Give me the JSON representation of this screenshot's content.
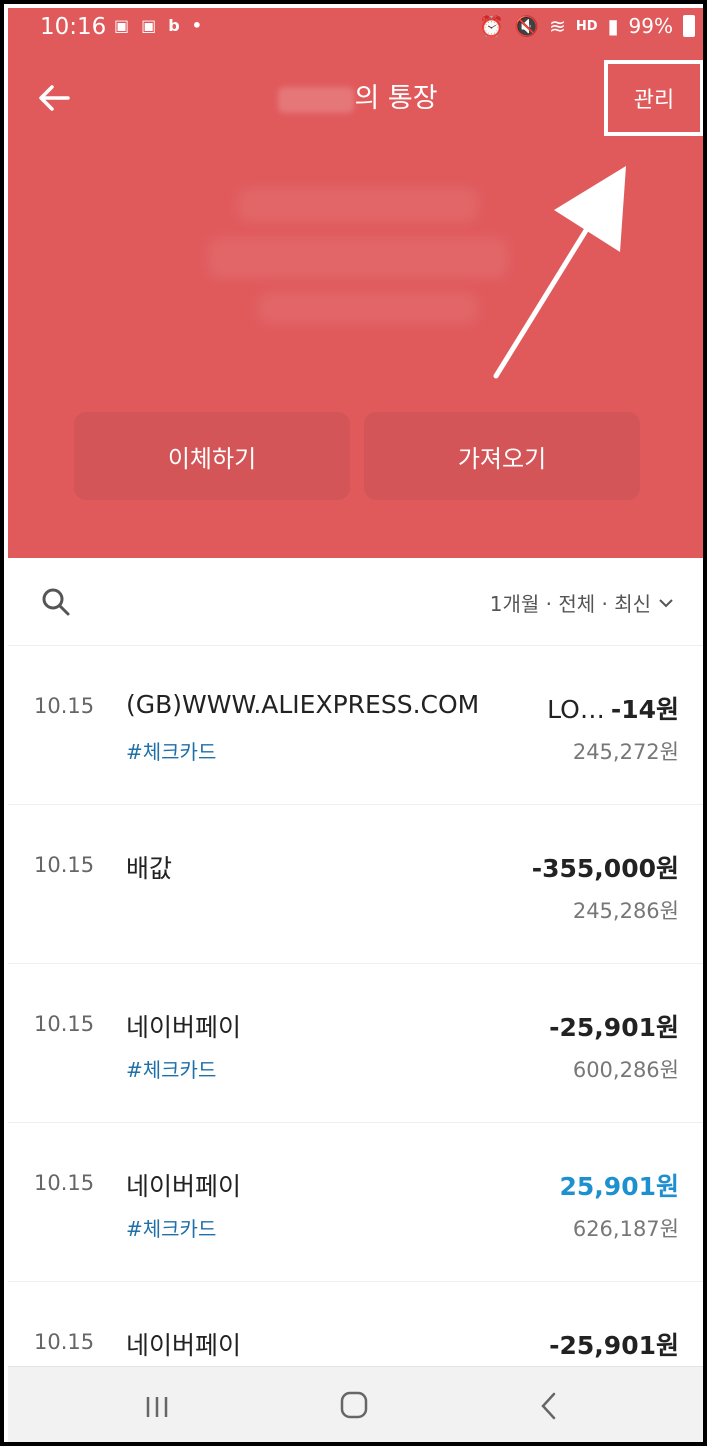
{
  "status_bar": {
    "time": "10:16",
    "battery": "99%",
    "hd_label": "HD"
  },
  "header": {
    "title_suffix": "의 통장",
    "manage_label": "관리"
  },
  "actions": {
    "transfer": "이체하기",
    "import": "가져오기"
  },
  "filter": {
    "label": "1개월 · 전체 · 최신"
  },
  "transactions": [
    {
      "date": "10.15",
      "merchant": "(GB)WWW.ALIEXPRESS.COM",
      "tag": "#체크카드",
      "amount_prefix": "LO…",
      "amount": "-14원",
      "balance": "245,272원"
    },
    {
      "date": "10.15",
      "merchant": "배값",
      "tag": "",
      "amount_prefix": "",
      "amount": "-355,000원",
      "balance": "245,286원"
    },
    {
      "date": "10.15",
      "merchant": "네이버페이",
      "tag": "#체크카드",
      "amount_prefix": "",
      "amount": "-25,901원",
      "balance": "600,286원"
    },
    {
      "date": "10.15",
      "merchant": "네이버페이",
      "tag": "#체크카드",
      "amount_prefix": "",
      "amount": "25,901원",
      "balance": "626,187원"
    },
    {
      "date": "10.15",
      "merchant": "네이버페이",
      "tag": "",
      "amount_prefix": "",
      "amount": "-25,901원",
      "balance": ""
    }
  ],
  "colors": {
    "header_bg": "#e05a5c",
    "positive_amount": "#1e8fcf",
    "tag": "#1f6fa8"
  }
}
